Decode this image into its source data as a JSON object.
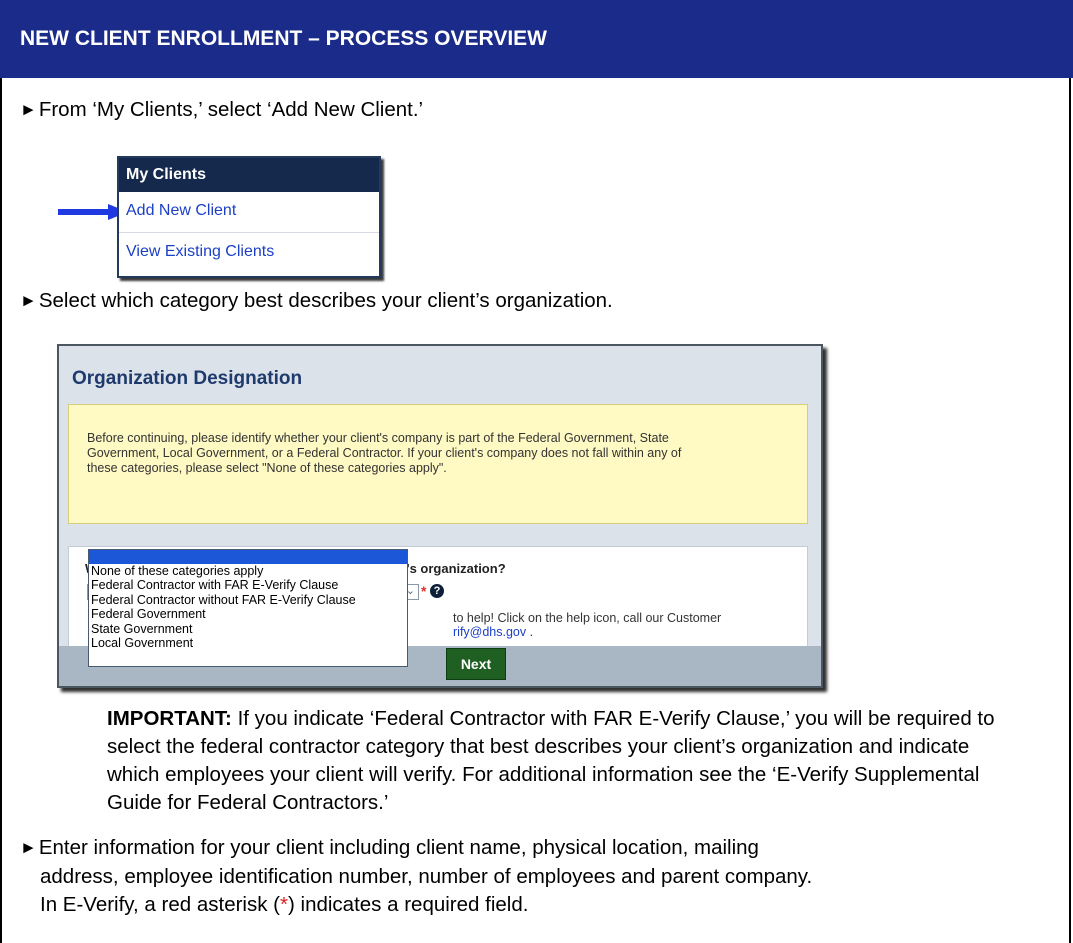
{
  "header": {
    "title": "NEW CLIENT ENROLLMENT – PROCESS OVERVIEW"
  },
  "steps": {
    "step1": "From ‘My Clients,’ select ‘Add New Client.’",
    "step2": "Select which category best describes your client’s organization.",
    "step3a": "Enter information for your client including client name, physical location, mailing",
    "step3b": "address, employee identification number, number of employees and parent company.",
    "step3c_pre": "In E-Verify, a red asterisk (",
    "step3c_star": "*",
    "step3c_post": ") indicates a required field."
  },
  "my_clients": {
    "heading": "My Clients",
    "items": [
      "Add New Client",
      "View Existing Clients"
    ]
  },
  "org_designation": {
    "title": "Organization Designation",
    "note_lines": [
      "Before continuing, please identify whether your client's company is part of the Federal Government, State",
      "Government, Local Government, or a Federal Contractor. If your client's company does not fall within any of",
      "these categories, please select \"None of these categories apply\"."
    ],
    "question": "Which category best describes your client company's organization?",
    "required_star": "*",
    "help_glyph": "?",
    "help_line1": "to help! Click on the help icon, call our Customer",
    "help_line2_email": "rify@dhs.gov",
    "help_line2_tail": " .",
    "next_label": "Next",
    "options": [
      "None of these categories apply",
      "Federal Contractor with FAR E-Verify Clause",
      "Federal Contractor without FAR E-Verify Clause",
      "Federal Government",
      "State Government",
      "Local Government"
    ]
  },
  "important": {
    "label": "IMPORTANT:",
    "text": " If you indicate ‘Federal Contractor with FAR E-Verify Clause,’ you will be required to select the federal contractor category that best describes your client’s organization and indicate which employees your client will verify. For additional information see the ‘E-Verify Supplemental Guide for Federal Contractors.’"
  },
  "colors": {
    "header_bg": "#1a2b8a",
    "link": "#1b3fc7",
    "required": "#e02020",
    "next_button": "#1f5f22"
  },
  "icons": {
    "bullet": "triangle-right",
    "pointer": "blue-arrow-right",
    "help": "question-circle",
    "dropdown_caret": "chevron-down"
  }
}
